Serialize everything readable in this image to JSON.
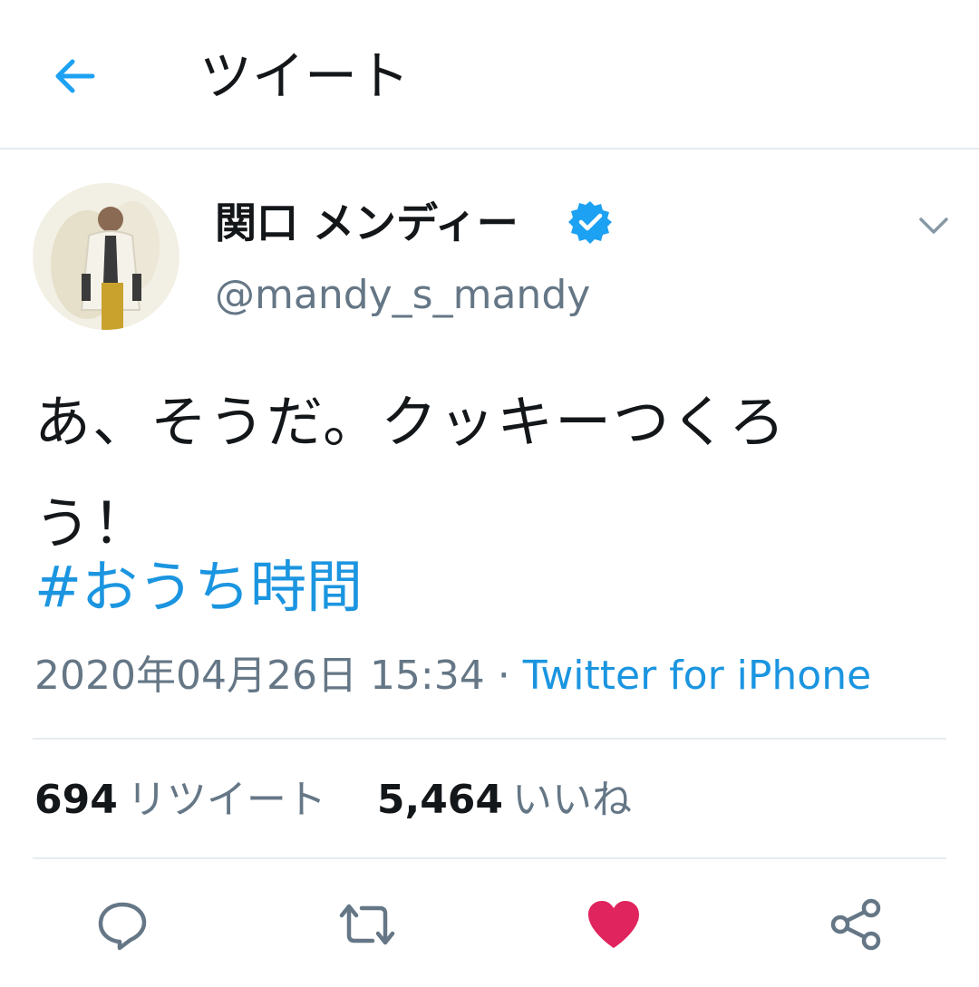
{
  "header": {
    "title": "ツイート",
    "back_icon": "arrow-left-icon",
    "accent_color": "#1da1f2"
  },
  "tweet": {
    "display_name": "関口 メンディー",
    "verified": true,
    "handle": "@mandy_s_mandy",
    "text_line1": "あ、そうだ。クッキーつくろ",
    "text_line2": "う！",
    "hashtag": "#おうち時間",
    "timestamp": "2020年04月26日 15:34",
    "separator": " · ",
    "source": "Twitter for iPhone"
  },
  "stats": {
    "retweets_count": "694",
    "retweets_label": "リツイート",
    "likes_count": "5,464",
    "likes_label": "いいね"
  },
  "actions": {
    "reply_icon": "reply-icon",
    "retweet_icon": "retweet-icon",
    "like_icon": "heart-icon",
    "share_icon": "share-icon",
    "liked": true,
    "like_color": "#e0245e",
    "icon_color": "#657786"
  }
}
